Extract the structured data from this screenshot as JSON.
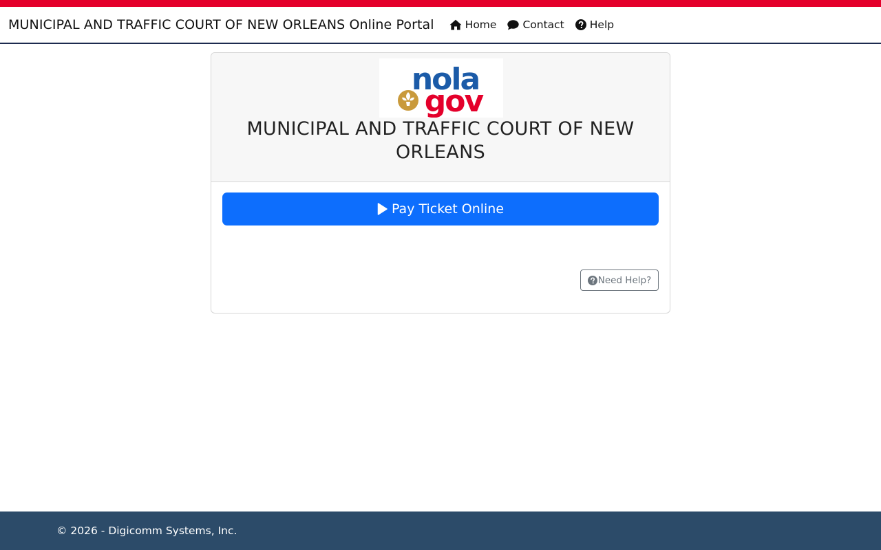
{
  "header": {
    "brand": "MUNICIPAL AND TRAFFIC COURT OF NEW ORLEANS Online Portal",
    "nav": {
      "home": "Home",
      "contact": "Contact",
      "help": "Help"
    }
  },
  "logo": {
    "top_text": "nola",
    "bottom_text": "gov",
    "colors": {
      "nola": "#1b5ba8",
      "gov": "#e4002b",
      "emblem": "#c99a3c"
    }
  },
  "card": {
    "title": "MUNICIPAL AND TRAFFIC COURT OF NEW ORLEANS",
    "pay_button": "Pay Ticket Online",
    "help_button": "Need Help?"
  },
  "footer": {
    "copyright": "© 2026 - Digicomm Systems, Inc."
  },
  "colors": {
    "accent_stripe": "#e4002b",
    "primary_button": "#0d6efd",
    "footer_bg": "#2c4b69",
    "nav_border": "#1d2b4f"
  }
}
